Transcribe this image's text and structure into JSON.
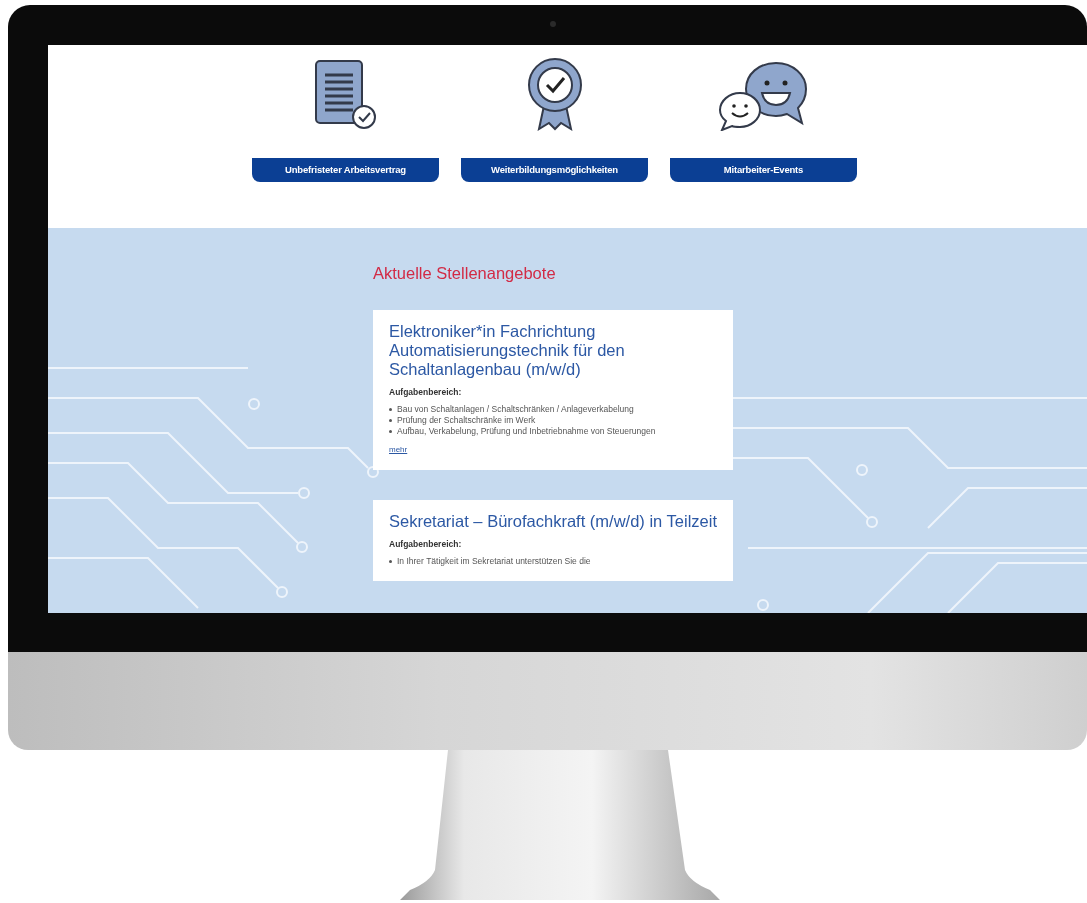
{
  "benefits": [
    {
      "kind": "document",
      "label": "Unbefristeter Arbeitsvertrag"
    },
    {
      "kind": "rosette",
      "label": "Weiterbildungsmöglichkeiten"
    },
    {
      "kind": "chat",
      "label": "Mitarbeiter-Events"
    }
  ],
  "jobs_heading": "Aktuelle Stellenangebote",
  "jobs": [
    {
      "title": "Elektroniker*in Fachrichtung Automatisierungstechnik für den Schaltanlagenbau (m/w/d)",
      "section_label": "Aufgabenbereich:",
      "tasks": [
        "Bau von Schaltanlagen / Schaltschränken / Anlageverkabelung",
        "Prüfung der Schaltschränke im Werk",
        "Aufbau, Verkabelung, Prüfung und Inbetriebnahme von Steuerungen"
      ],
      "link": "mehr"
    },
    {
      "title": "Sekretariat – Bürofachkraft (m/w/d) in Teilzeit",
      "section_label": "Aufgabenbereich:",
      "tasks": [
        "In Ihrer Tätigkeit im Sekretariat unterstützen Sie die"
      ]
    }
  ]
}
